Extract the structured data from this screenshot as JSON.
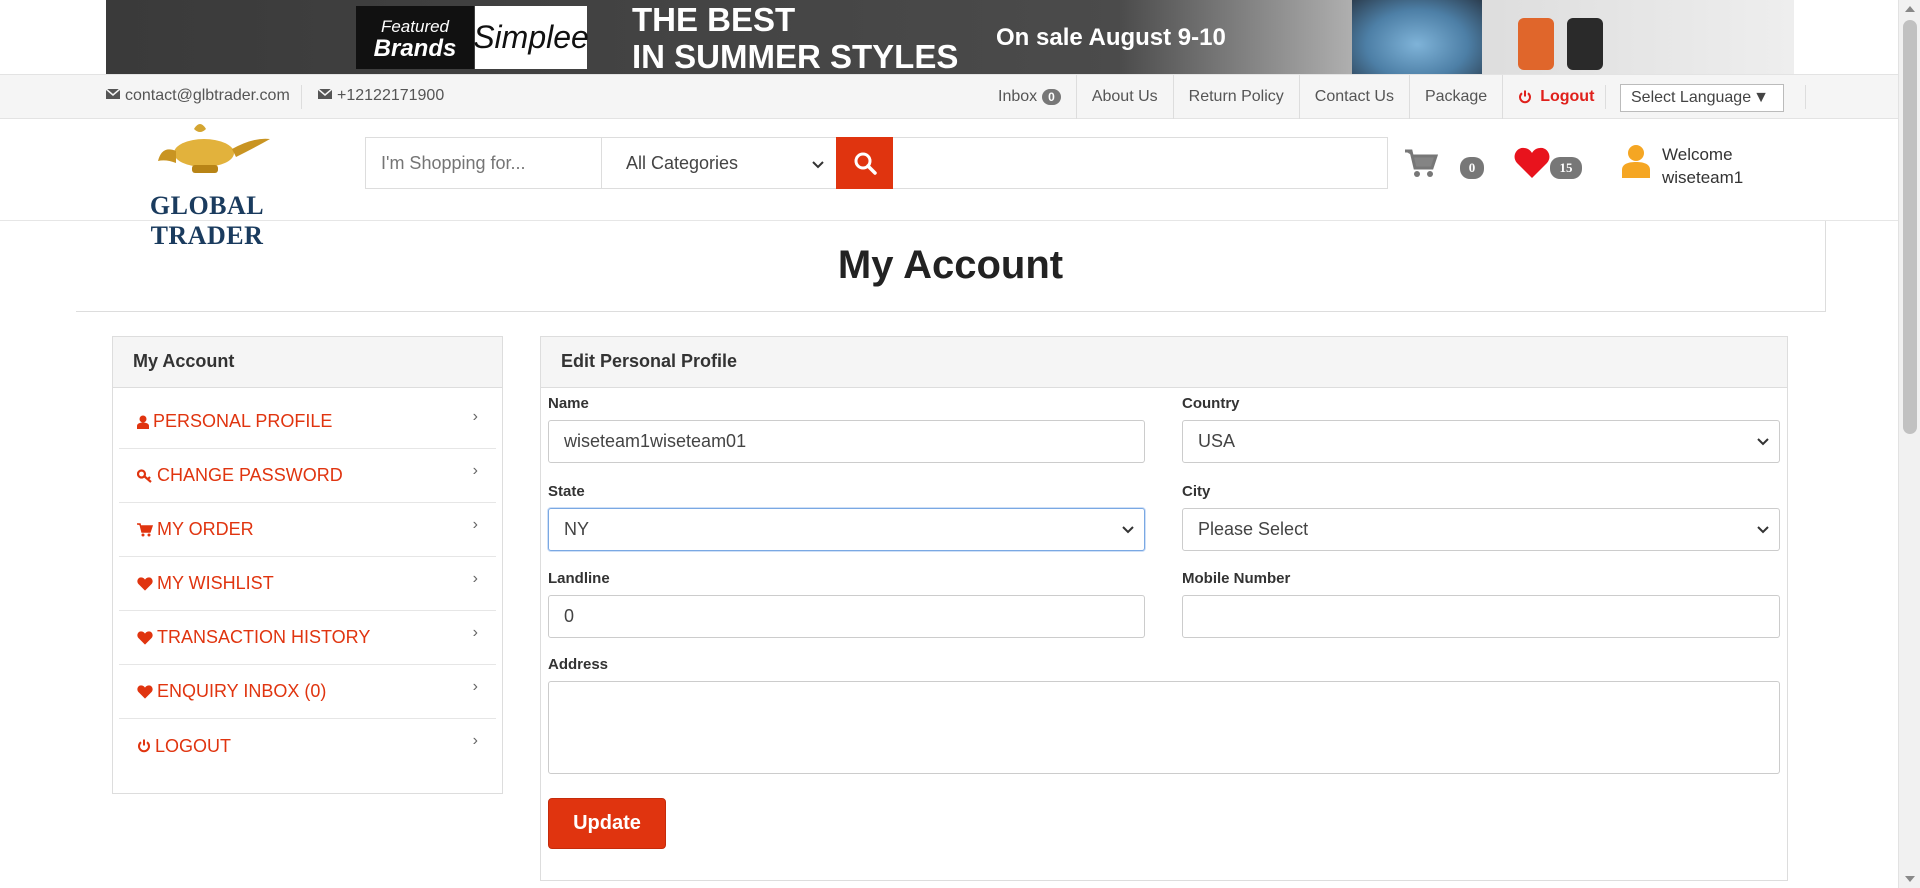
{
  "banner": {
    "brand_line1": "Featured",
    "brand_line2": "Brands",
    "brand_name": "Simplee",
    "headline_line1": "THE BEST",
    "headline_line2": "IN SUMMER STYLES",
    "sale_text": "On sale August 9-10"
  },
  "topbar": {
    "email": "contact@glbtrader.com",
    "phone": "+12122171900",
    "nav": {
      "inbox": "Inbox",
      "inbox_count": "0",
      "about": "About Us",
      "return_policy": "Return Policy",
      "contact": "Contact Us",
      "package": "Package",
      "logout": "Logout"
    },
    "language": "Select Language"
  },
  "header": {
    "logo_text": "GLOBAL TRADER",
    "search_placeholder": "I'm Shopping for...",
    "category": "All Categories",
    "cart_count": "0",
    "wishlist_count": "15",
    "welcome_label": "Welcome",
    "username": "wiseteam1"
  },
  "page": {
    "title": "My Account"
  },
  "sidebar": {
    "heading": "My Account",
    "items": [
      {
        "label": "PERSONAL PROFILE"
      },
      {
        "label": "CHANGE PASSWORD"
      },
      {
        "label": "MY ORDER"
      },
      {
        "label": "MY WISHLIST"
      },
      {
        "label": "TRANSACTION HISTORY"
      },
      {
        "label": "ENQUIRY INBOX (0)"
      },
      {
        "label": "LOGOUT"
      }
    ]
  },
  "form": {
    "heading": "Edit Personal Profile",
    "name_label": "Name",
    "name_value": "wiseteam1wiseteam01",
    "country_label": "Country",
    "country_value": "USA",
    "state_label": "State",
    "state_value": "NY",
    "city_label": "City",
    "city_value": "Please Select",
    "landline_label": "Landline",
    "landline_value": "0",
    "mobile_label": "Mobile Number",
    "mobile_value": "",
    "address_label": "Address",
    "address_value": "",
    "submit_label": "Update"
  },
  "colors": {
    "accent": "#e0340f",
    "logout_red": "#e0201b",
    "badge_gray": "#777777",
    "heart_red": "#e8131d",
    "user_orange": "#f5a623"
  }
}
